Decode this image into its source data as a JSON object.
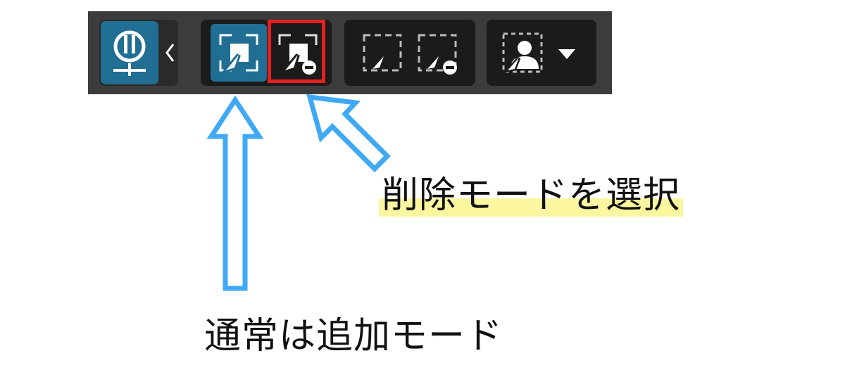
{
  "toolbar": {
    "buttons": [
      {
        "name": "plugin-button",
        "icon": "plugin-icon",
        "state": "active"
      },
      {
        "name": "collapse-button",
        "icon": "chevron-left-icon"
      },
      {
        "name": "add-selection-mode",
        "icon": "select-add-icon",
        "state": "active"
      },
      {
        "name": "subtract-selection-mode",
        "icon": "select-subtract-icon",
        "state": "highlighted"
      },
      {
        "name": "marquee-add",
        "icon": "marquee-add-icon"
      },
      {
        "name": "marquee-subtract",
        "icon": "marquee-subtract-icon"
      },
      {
        "name": "subject-select",
        "icon": "person-select-icon"
      },
      {
        "name": "subject-dropdown",
        "icon": "caret-down-icon"
      }
    ],
    "accent_color": "#216e94",
    "highlight_color": "#e62020"
  },
  "annotations": {
    "delete_mode_label": "削除モードを選択",
    "add_mode_label": "通常は追加モード",
    "arrow_color": "#3fa9f5",
    "label_highlight_color": "#fbf7a0"
  }
}
